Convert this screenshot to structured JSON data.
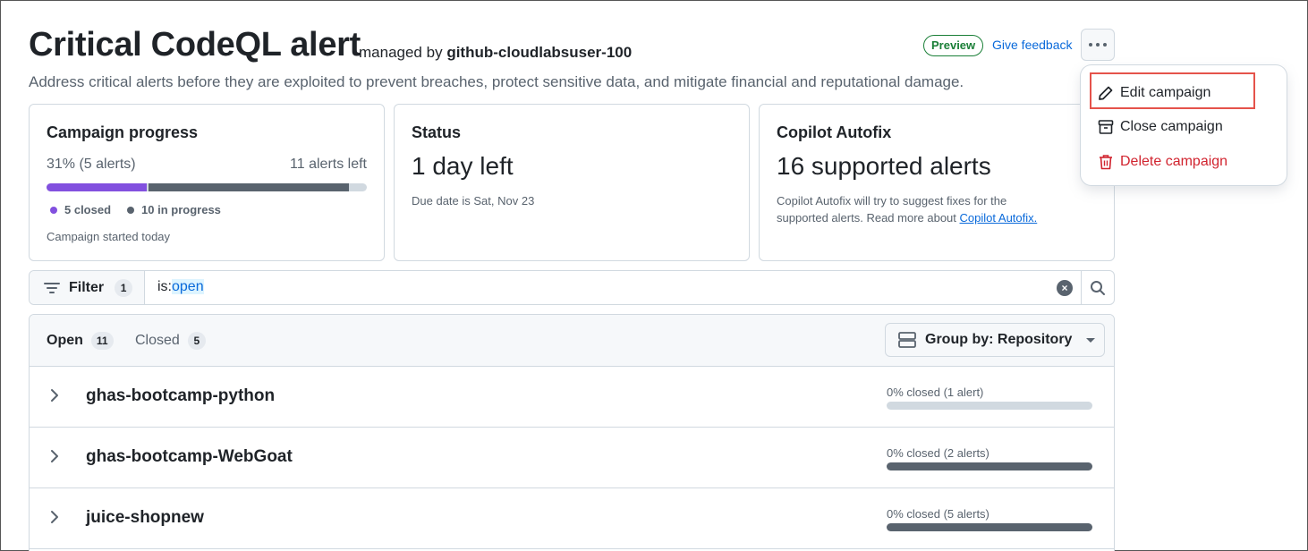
{
  "header": {
    "title": "Critical CodeQL alert",
    "managed_prefix": "managed by",
    "managed_by": "github-cloudlabsuser-100",
    "description": "Address critical alerts before they are exploited to prevent breaches, protect sensitive data, and mitigate financial and reputational damage.",
    "preview_badge": "Preview",
    "feedback_link": "Give feedback"
  },
  "menu": {
    "items": [
      {
        "label": "Edit campaign",
        "icon": "pencil-icon"
      },
      {
        "label": "Close campaign",
        "icon": "archive-icon"
      },
      {
        "label": "Delete campaign",
        "icon": "trash-icon"
      }
    ]
  },
  "cards": {
    "progress": {
      "title": "Campaign progress",
      "percent_text": "31% (5 alerts)",
      "left_text": "11 alerts left",
      "closed_fraction": 0.3125,
      "in_progress_fraction": 0.625,
      "legend_closed": "5 closed",
      "legend_in_progress": "10 in progress",
      "started": "Campaign started today"
    },
    "status": {
      "title": "Status",
      "value": "1 day left",
      "note": "Due date is Sat, Nov 23"
    },
    "autofix": {
      "title": "Copilot Autofix",
      "value": "16 supported alerts",
      "note_line1": "Copilot Autofix will try to suggest fixes for the",
      "note_line2": "supported alerts. Read more about",
      "link": "Copilot Autofix."
    }
  },
  "filter": {
    "button_label": "Filter",
    "count": "1",
    "query_key": "is:",
    "query_value": "open"
  },
  "list": {
    "tab_open": "Open",
    "tab_open_count": "11",
    "tab_closed": "Closed",
    "tab_closed_count": "5",
    "group_by": "Group by: Repository",
    "rows": [
      {
        "repo": "ghas-bootcamp-python",
        "status": "0% closed (1 alert)",
        "bar": "light"
      },
      {
        "repo": "ghas-bootcamp-WebGoat",
        "status": "0% closed (2 alerts)",
        "bar": "dark"
      },
      {
        "repo": "juice-shopnew",
        "status": "0% closed (5 alerts)",
        "bar": "dark"
      }
    ]
  },
  "colors": {
    "closed": "#8250df",
    "in_progress": "#59636e",
    "accent_link": "#0969da",
    "danger": "#d1242f",
    "success": "#1a7f37"
  }
}
